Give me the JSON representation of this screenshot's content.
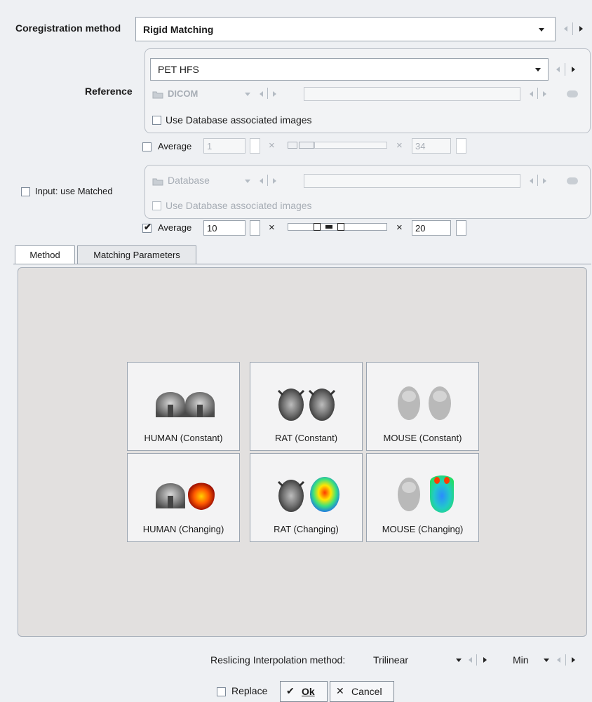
{
  "coregistration": {
    "label": "Coregistration method",
    "value": "Rigid Matching"
  },
  "reference": {
    "label": "Reference",
    "series_value": "PET HFS",
    "source_value": "DICOM",
    "use_db_label": "Use Database associated images",
    "average_label": "Average",
    "average_from": "1",
    "average_to": "34",
    "times": "×"
  },
  "input": {
    "label": "Input: use Matched",
    "source_value": "Database",
    "use_db_label": "Use Database associated images",
    "average_label": "Average",
    "average_from": "10",
    "average_to": "20",
    "average_checked": true,
    "times": "×"
  },
  "tabs": [
    {
      "label": "Method"
    },
    {
      "label": "Matching Parameters"
    }
  ],
  "methods": [
    {
      "label": "HUMAN (Constant)"
    },
    {
      "label": "RAT (Constant)"
    },
    {
      "label": "MOUSE (Constant)"
    },
    {
      "label": "HUMAN (Changing)"
    },
    {
      "label": "RAT (Changing)"
    },
    {
      "label": "MOUSE (Changing)"
    }
  ],
  "reslicing": {
    "label": "Reslicing Interpolation method:",
    "value": "Trilinear",
    "min_value": "Min"
  },
  "footer": {
    "replace_label": "Replace",
    "ok_label": "Ok",
    "cancel_label": "Cancel",
    "check_glyph": "✔",
    "cross_glyph": "✕"
  },
  "colors": {
    "accent_bg": "#eef0f3",
    "panel_bg": "#e2e0df",
    "border": "#9aa3ad"
  }
}
